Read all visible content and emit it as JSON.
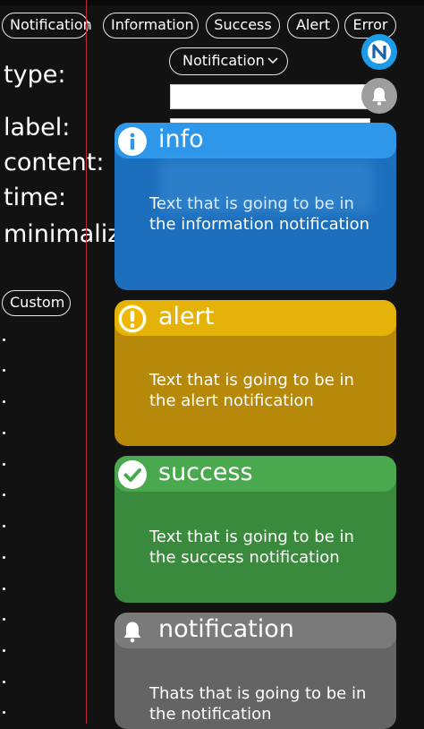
{
  "tabs": [
    "Notification",
    "Information",
    "Success",
    "Alert",
    "Error"
  ],
  "form": {
    "type_label": "type:",
    "label_label": "label:",
    "content_label": "content:",
    "time_label": "time:",
    "minimalize_label": "minimaliz",
    "type_value": "Notification"
  },
  "custom_button": "Custom",
  "cards": {
    "info": {
      "title": "info",
      "body": "Text that is going to be in the information notification",
      "icon": "info-icon"
    },
    "alert": {
      "title": "alert",
      "body": "Text that is going to be in the alert notification",
      "icon": "exclamation-icon"
    },
    "success": {
      "title": "success",
      "body": "Text that is going to be in the success notification",
      "icon": "check-icon"
    },
    "notification": {
      "title": "notification",
      "body": "Thats that is going to be in the notification",
      "icon": "bell-icon"
    }
  },
  "colors": {
    "info": "#2f97ea",
    "alert": "#e5b209",
    "success": "#4aa84e",
    "notification": "#7a7a7a",
    "logo": "#1e9be8"
  }
}
